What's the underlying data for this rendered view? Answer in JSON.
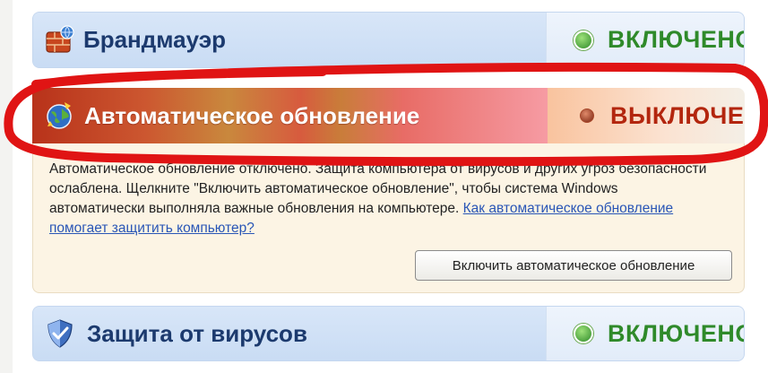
{
  "colors": {
    "on_green": "#2f8a2a",
    "off_red": "#b3260e",
    "annotation_red": "#e01414",
    "link_blue": "#2a56b6"
  },
  "items": [
    {
      "icon": "firewall-icon",
      "title": "Брандмауэр",
      "status": "ВКЛЮЧЕНО",
      "status_color": "#2f8a2a",
      "expander": "chevron-down-icon"
    },
    {
      "icon": "globe-update-icon",
      "title": "Автоматическое обновление",
      "status": "ВЫКЛЮЧЕНО",
      "status_color": "#b3260e",
      "expander": "chevron-up-icon"
    },
    {
      "icon": "shield-icon",
      "title": "Защита от вирусов",
      "status": "ВКЛЮЧЕНО",
      "status_color": "#2f8a2a",
      "expander": "chevron-down-icon"
    }
  ],
  "details": {
    "text": "Автоматическое обновление отключено. Защита компьютера от вирусов и других угроз безопасности ослаблена. Щелкните \"Включить автоматическое обновление\", чтобы система Windows автоматически выполняла важные обновления на компьютере.",
    "link": "Как автоматическое обновление помогает защитить компьютер?",
    "button": "Включить автоматическое обновление"
  }
}
